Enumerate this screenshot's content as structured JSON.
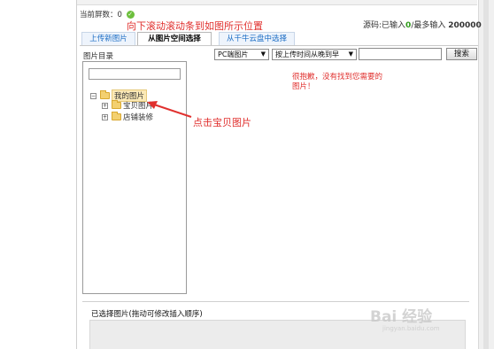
{
  "header": {
    "screen_count_label": "当前屏数：0",
    "annotation_scroll": "向下滚动滚动条到如图所示位置",
    "source_prefix": "源码:已输入",
    "source_current": "0",
    "source_middle": "/最多输入",
    "source_max": "200000"
  },
  "tabs": [
    {
      "label": "上传新图片"
    },
    {
      "label": "从图片空间选择"
    },
    {
      "label": "从千牛云盘中选择"
    }
  ],
  "directory": {
    "label": "图片目录",
    "search_value": "",
    "tree": [
      {
        "label": "我的图片",
        "expander": "−"
      },
      {
        "label": "宝贝图片",
        "expander": "+"
      },
      {
        "label": "店铺装修",
        "expander": "+"
      }
    ]
  },
  "filters": {
    "device_select": "PC端图片",
    "sort_select": "按上传时间从晚到早",
    "search_value": "",
    "search_button": "搜索"
  },
  "empty_message": "很抱歉，没有找到您需要的图片！",
  "annotation_click": "点击宝贝图片",
  "selected_section": {
    "label": "已选择图片(拖动可修改插入顺序)"
  },
  "watermark": {
    "text": "Bai 经验",
    "sub": "jingyan.baidu.com"
  },
  "colors": {
    "annotation": "#e0302e",
    "accent_tab": "#1a6cc4",
    "count_green": "#2e9a1a"
  }
}
